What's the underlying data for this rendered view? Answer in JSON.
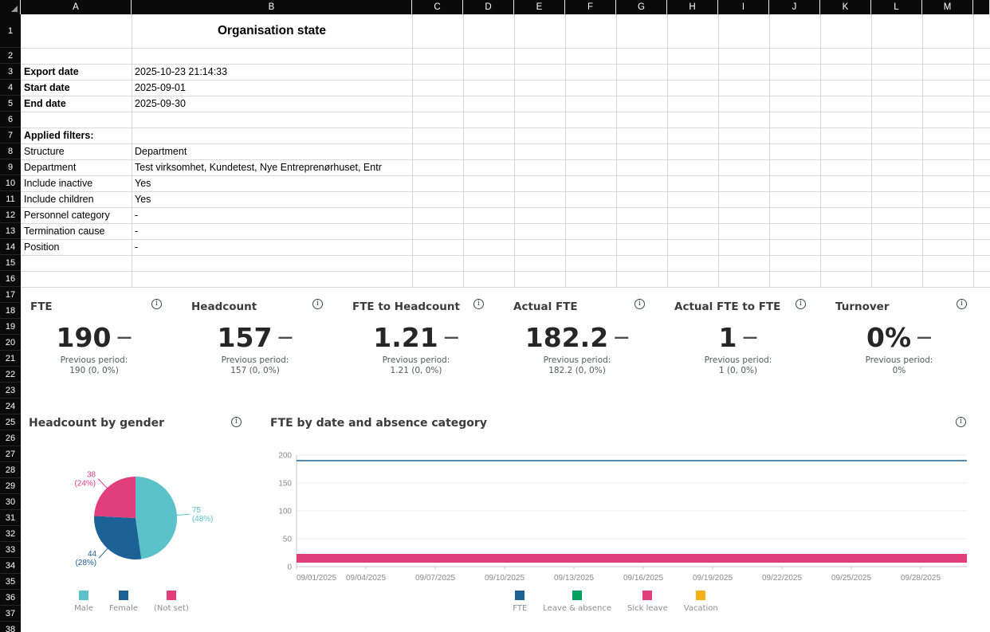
{
  "sheet": {
    "columns": [
      "A",
      "B",
      "C",
      "D",
      "E",
      "F",
      "G",
      "H",
      "I",
      "J",
      "K",
      "L",
      "M"
    ],
    "row_count": 38,
    "title_cell": {
      "ref": "B1",
      "text": "Organisation state"
    },
    "info_rows": [
      {
        "row": 3,
        "label": "Export date",
        "value": "2025-10-23 21:14:33",
        "bold_label": true
      },
      {
        "row": 4,
        "label": "Start date",
        "value": "2025-09-01",
        "bold_label": true
      },
      {
        "row": 5,
        "label": "End date",
        "value": "2025-09-30",
        "bold_label": true
      },
      {
        "row": 7,
        "label": "Applied filters:",
        "value": "",
        "bold_label": true
      },
      {
        "row": 8,
        "label": "Structure",
        "value": "Department",
        "bold_label": false
      },
      {
        "row": 9,
        "label": "Department",
        "value": "Test virksomhet, Kundetest, Nye Entreprenørhuset, Entr",
        "bold_label": false
      },
      {
        "row": 10,
        "label": "Include inactive",
        "value": "Yes",
        "bold_label": false
      },
      {
        "row": 11,
        "label": "Include children",
        "value": "Yes",
        "bold_label": false
      },
      {
        "row": 12,
        "label": "Personnel category",
        "value": "-",
        "bold_label": false
      },
      {
        "row": 13,
        "label": "Termination cause",
        "value": "-",
        "bold_label": false
      },
      {
        "row": 14,
        "label": "Position",
        "value": "-",
        "bold_label": false
      }
    ]
  },
  "kpis": [
    {
      "title": "FTE",
      "value": "190",
      "trend_indicator": "—",
      "previous_label": "Previous period:",
      "previous_value": "190 (0, 0%)"
    },
    {
      "title": "Headcount",
      "value": "157",
      "trend_indicator": "—",
      "previous_label": "Previous period:",
      "previous_value": "157 (0, 0%)"
    },
    {
      "title": "FTE to Headcount",
      "value": "1.21",
      "trend_indicator": "—",
      "previous_label": "Previous period:",
      "previous_value": "1.21 (0, 0%)"
    },
    {
      "title": "Actual FTE",
      "value": "182.2",
      "trend_indicator": "—",
      "previous_label": "Previous period:",
      "previous_value": "182.2 (0, 0%)"
    },
    {
      "title": "Actual FTE to FTE",
      "value": "1",
      "trend_indicator": "—",
      "previous_label": "Previous period:",
      "previous_value": "1 (0, 0%)"
    },
    {
      "title": "Turnover",
      "value": "0%",
      "trend_indicator": "—",
      "previous_label": "Previous period:",
      "previous_value": "0%"
    }
  ],
  "chart_data": [
    {
      "type": "pie",
      "title": "Headcount by gender",
      "slices": [
        {
          "label": "Male",
          "value": 75,
          "pct_label": "48%",
          "color": "#5bc2c9"
        },
        {
          "label": "Female",
          "value": 44,
          "pct_label": "28%",
          "color": "#1d6296"
        },
        {
          "label": "(Not set)",
          "value": 38,
          "pct_label": "24%",
          "color": "#e23e7c"
        }
      ],
      "legend_position": "bottom"
    },
    {
      "type": "line",
      "title": "FTE by date and absence category",
      "x_tick_labels": [
        "09/01/2025",
        "09/04/2025",
        "09/07/2025",
        "09/10/2025",
        "09/13/2025",
        "09/16/2025",
        "09/19/2025",
        "09/22/2025",
        "09/25/2025",
        "09/28/2025"
      ],
      "x_range_days": 30,
      "ylim": [
        0,
        200
      ],
      "yticks": [
        0,
        50,
        100,
        150,
        200
      ],
      "series": [
        {
          "name": "FTE",
          "color": "#1d6296",
          "style": "line",
          "values": [
            190,
            190,
            190,
            190,
            190,
            190,
            190,
            190,
            190,
            190
          ]
        },
        {
          "name": "Leave & absence",
          "color": "#00a15f",
          "style": "line",
          "values": [
            0,
            0,
            0,
            0,
            0,
            0,
            0,
            0,
            0,
            0
          ]
        },
        {
          "name": "Sick leave",
          "color": "#e23e7c",
          "style": "thick-line",
          "values": [
            15,
            15,
            15,
            15,
            15,
            15,
            15,
            15,
            15,
            15
          ]
        },
        {
          "name": "Vacation",
          "color": "#f8b018",
          "style": "line",
          "values": [
            0,
            0,
            0,
            0,
            0,
            0,
            0,
            0,
            0,
            0
          ]
        }
      ],
      "legend_position": "bottom"
    }
  ],
  "icons": {
    "info_glyph": "i"
  }
}
